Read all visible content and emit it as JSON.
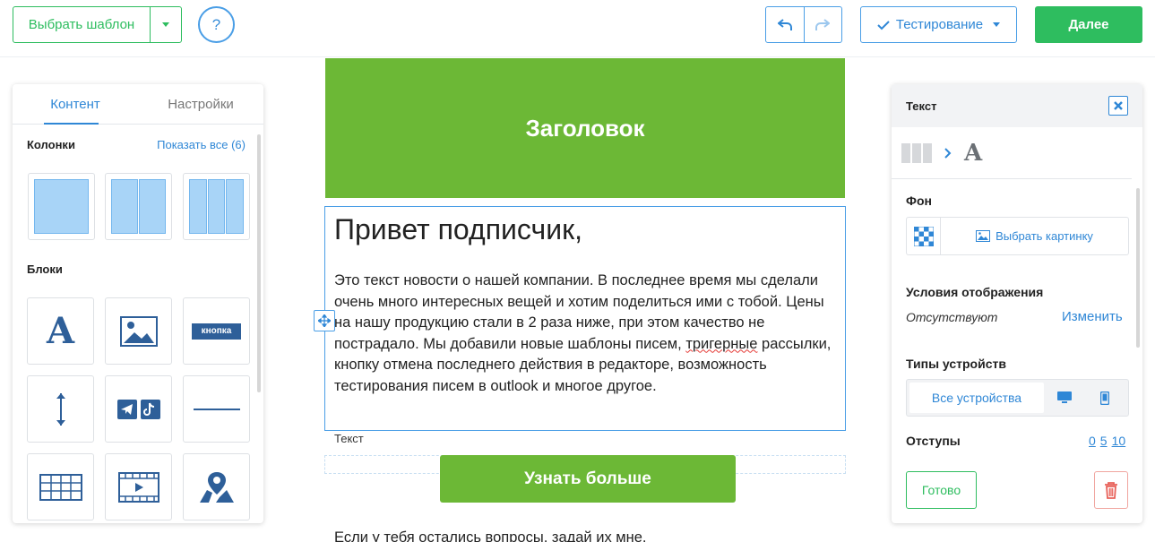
{
  "toolbar": {
    "choose_template": "Выбрать шаблон",
    "help": "?",
    "testing": "Тестирование",
    "next": "Далее"
  },
  "email": {
    "header_title": "Заголовок",
    "greeting": "Привет подписчик,",
    "body_before": "Это текст новости о нашей компании. В последнее время мы сделали очень много интересных вещей и хотим поделиться ими с тобой. Цены на нашу продукцию стали в 2 раза ниже, при этом качество не пострадало. Мы добавили новые шаблоны писем, ",
    "body_misspelled": "тригерные",
    "body_after": " рассылки, кнопку отмена последнего действия в редакторе, возможность тестирования писем в outlook и многое другое.",
    "block_label": "Текст",
    "cta_label": "Узнать больше",
    "footer_text": "Если у тебя остались вопросы, задай их мне."
  },
  "left_panel": {
    "tabs": [
      "Контент",
      "Настройки"
    ],
    "active_tab": "Контент",
    "columns_title": "Колонки",
    "show_all": "Показать все (6)",
    "blocks_title": "Блоки",
    "button_block_label": "кнопка",
    "block_icons": [
      "text-icon",
      "image-icon",
      "button-icon",
      "spacer-icon",
      "social-icon",
      "divider-icon",
      "table-icon",
      "video-icon",
      "map-icon"
    ]
  },
  "right_panel": {
    "title": "Текст",
    "background_label": "Фон",
    "choose_image": "Выбрать картинку",
    "display_conditions_label": "Условия отображения",
    "display_conditions_value": "Отсутствуют",
    "change": "Изменить",
    "device_types_label": "Типы устройств",
    "all_devices": "Все устройства",
    "paddings_label": "Отступы",
    "padding_values": [
      "0",
      "5",
      "10"
    ],
    "done": "Готово"
  },
  "colors": {
    "brand_green": "#2ebd5f",
    "email_green": "#6cb836",
    "accent_blue": "#2f87d6",
    "delete_red": "#e8625a"
  }
}
